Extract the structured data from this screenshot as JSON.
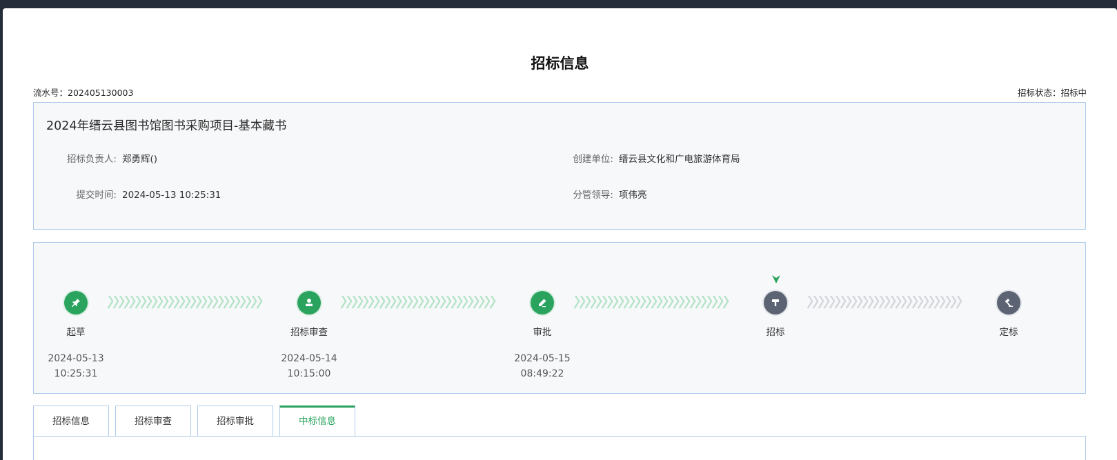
{
  "page": {
    "title": "招标信息",
    "serial_label": "流水号：",
    "serial_value": "202405130003",
    "status_label": "招标状态：",
    "status_value": "招标中"
  },
  "info": {
    "project_name": "2024年缙云县图书馆图书采购项目-基本藏书",
    "owner_label": "招标负责人:",
    "owner_value": "郑勇辉()",
    "submit_label": "提交时间:",
    "submit_value": "2024-05-13 10:25:31",
    "unit_label": "创建单位:",
    "unit_value": "缙云县文化和广电旅游体育局",
    "leader_label": "分管领导:",
    "leader_value": "项伟亮"
  },
  "flow": {
    "steps": [
      {
        "name": "起草",
        "date": "2024-05-13",
        "time": "10:25:31",
        "state": "done",
        "icon": "pin-icon"
      },
      {
        "name": "招标审查",
        "date": "2024-05-14",
        "time": "10:15:00",
        "state": "done",
        "icon": "user-stamp-icon"
      },
      {
        "name": "审批",
        "date": "2024-05-15",
        "time": "08:49:22",
        "state": "done",
        "icon": "pencil-icon"
      },
      {
        "name": "招标",
        "date": "",
        "time": "",
        "state": "current",
        "icon": "bid-icon"
      },
      {
        "name": "定标",
        "date": "",
        "time": "",
        "state": "todo",
        "icon": "gavel-icon"
      }
    ]
  },
  "tabs": [
    {
      "label": "招标信息",
      "active": false
    },
    {
      "label": "招标审查",
      "active": false
    },
    {
      "label": "招标审批",
      "active": false
    },
    {
      "label": "中标信息",
      "active": true
    }
  ],
  "colors": {
    "accent": "#2aa35e",
    "pending": "#5c6474",
    "border": "#aecbea"
  }
}
